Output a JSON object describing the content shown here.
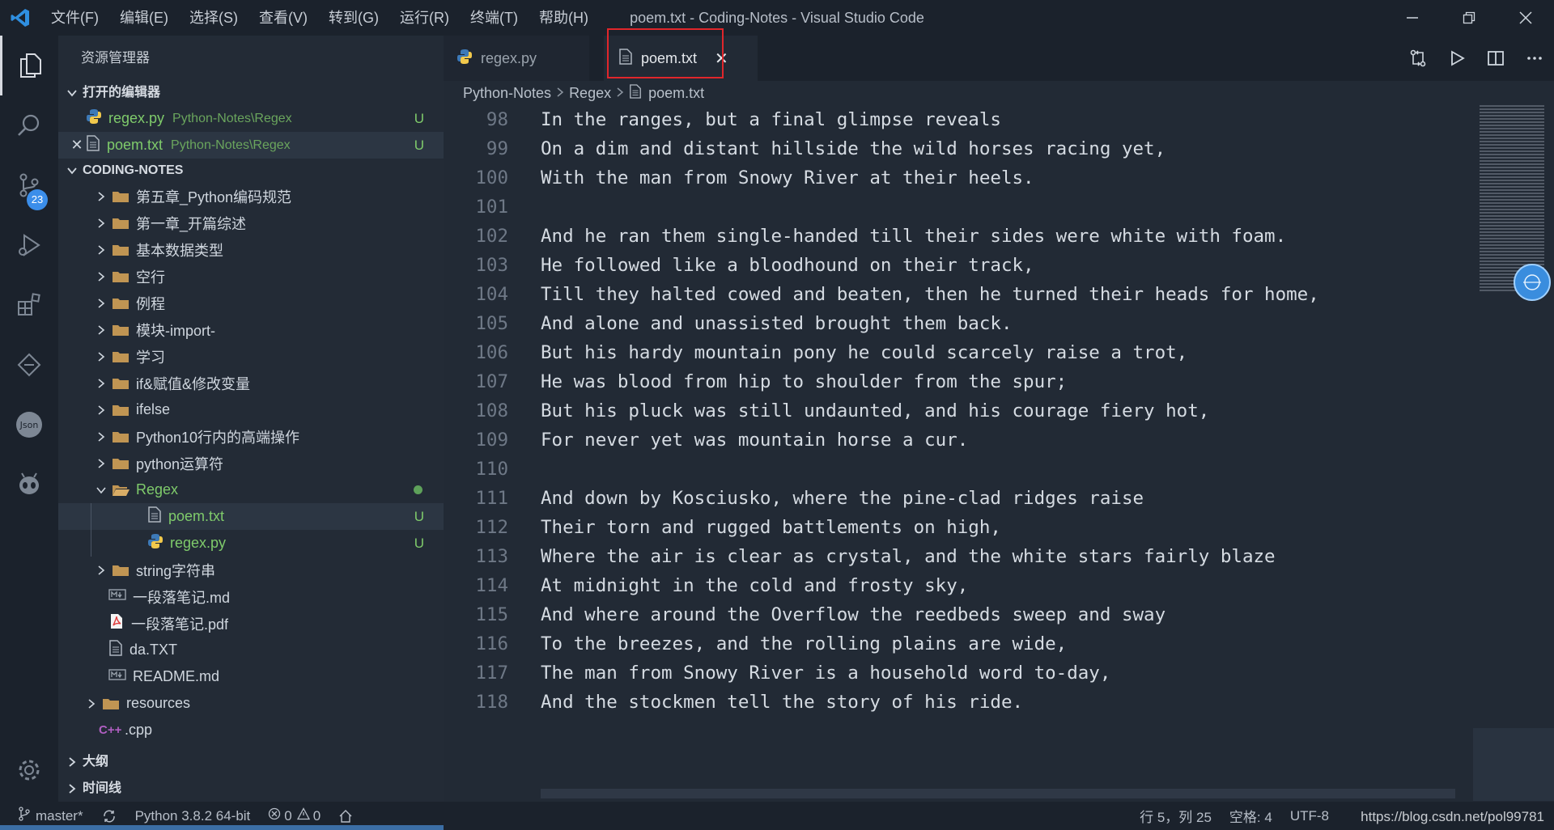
{
  "titlebar": {
    "menu": [
      "文件(F)",
      "编辑(E)",
      "选择(S)",
      "查看(V)",
      "转到(G)",
      "运行(R)",
      "终端(T)",
      "帮助(H)"
    ],
    "window_title": "poem.txt - Coding-Notes - Visual Studio Code"
  },
  "activitybar": {
    "scm_badge": "23"
  },
  "sidebar": {
    "title": "资源管理器",
    "open_editors_header": "打开的编辑器",
    "open_editors": [
      {
        "name": "regex.py",
        "path": "Python-Notes\\Regex",
        "status": "U"
      },
      {
        "name": "poem.txt",
        "path": "Python-Notes\\Regex",
        "status": "U"
      }
    ],
    "workspace_header": "CODING-NOTES",
    "tree": [
      {
        "name": "第五章_Python编码规范"
      },
      {
        "name": "第一章_开篇综述"
      },
      {
        "name": "基本数据类型"
      },
      {
        "name": "空行"
      },
      {
        "name": "例程"
      },
      {
        "name": "模块-import-"
      },
      {
        "name": "学习"
      },
      {
        "name": "if&赋值&修改变量"
      },
      {
        "name": "ifelse"
      },
      {
        "name": "Python10行内的高端操作"
      },
      {
        "name": "python运算符"
      },
      {
        "name": "Regex"
      },
      {
        "name": "poem.txt",
        "status": "U"
      },
      {
        "name": "regex.py",
        "status": "U"
      },
      {
        "name": "string字符串"
      },
      {
        "name": "一段落笔记.md"
      },
      {
        "name": "一段落笔记.pdf"
      },
      {
        "name": "da.TXT"
      },
      {
        "name": "README.md"
      },
      {
        "name": "resources"
      },
      {
        "name": ".cpp"
      }
    ],
    "outline_header": "大纲",
    "timeline_header": "时间线"
  },
  "tabs": [
    {
      "label": "regex.py"
    },
    {
      "label": "poem.txt"
    }
  ],
  "breadcrumb": [
    "Python-Notes",
    "Regex",
    "poem.txt"
  ],
  "editor": {
    "lines": [
      {
        "n": "98",
        "t": "In the ranges, but a final glimpse reveals"
      },
      {
        "n": "99",
        "t": "On a dim and distant hillside the wild horses racing yet,"
      },
      {
        "n": "100",
        "t": "With the man from Snowy River at their heels."
      },
      {
        "n": "101",
        "t": ""
      },
      {
        "n": "102",
        "t": "And he ran them single-handed till their sides were white with foam."
      },
      {
        "n": "103",
        "t": "He followed like a bloodhound on their track,"
      },
      {
        "n": "104",
        "t": "Till they halted cowed and beaten, then he turned their heads for home,"
      },
      {
        "n": "105",
        "t": "And alone and unassisted brought them back."
      },
      {
        "n": "106",
        "t": "But his hardy mountain pony he could scarcely raise a trot,"
      },
      {
        "n": "107",
        "t": "He was blood from hip to shoulder from the spur;"
      },
      {
        "n": "108",
        "t": "But his pluck was still undaunted, and his courage fiery hot,"
      },
      {
        "n": "109",
        "t": "For never yet was mountain horse a cur."
      },
      {
        "n": "110",
        "t": ""
      },
      {
        "n": "111",
        "t": "And down by Kosciusko, where the pine-clad ridges raise"
      },
      {
        "n": "112",
        "t": "Their torn and rugged battlements on high,"
      },
      {
        "n": "113",
        "t": "Where the air is clear as crystal, and the white stars fairly blaze"
      },
      {
        "n": "114",
        "t": "At midnight in the cold and frosty sky,"
      },
      {
        "n": "115",
        "t": "And where around the Overflow the reedbeds sweep and sway"
      },
      {
        "n": "116",
        "t": "To the breezes, and the rolling plains are wide,"
      },
      {
        "n": "117",
        "t": "The man from Snowy River is a household word to-day,"
      },
      {
        "n": "118",
        "t": "And the stockmen tell the story of his ride."
      }
    ]
  },
  "statusbar": {
    "branch": "master*",
    "python": "Python 3.8.2 64-bit",
    "errors": "0",
    "warnings": "0",
    "position": "行 5，列 25",
    "spaces": "空格: 4",
    "encoding": "UTF-8",
    "watermark": "https://blog.csdn.net/pol99781"
  },
  "colors": {
    "accent": "#3b8eea",
    "untracked": "#7fcb6b",
    "highlight_box": "#e0262b"
  }
}
